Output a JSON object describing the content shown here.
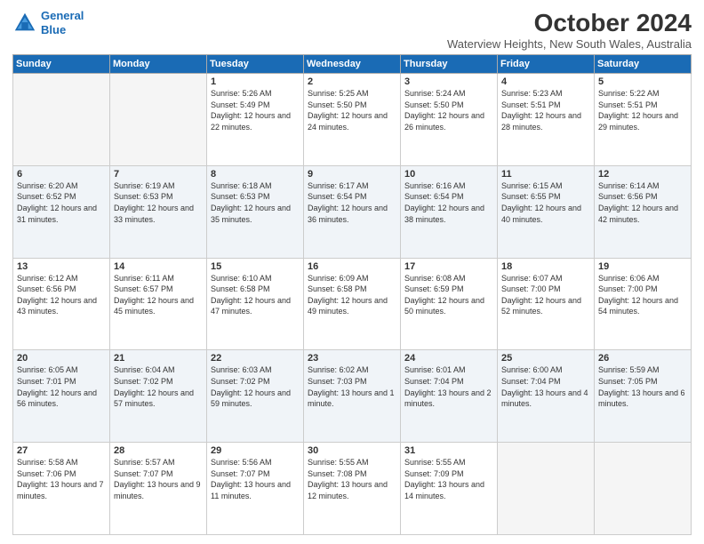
{
  "logo": {
    "line1": "General",
    "line2": "Blue"
  },
  "title": "October 2024",
  "subtitle": "Waterview Heights, New South Wales, Australia",
  "headers": [
    "Sunday",
    "Monday",
    "Tuesday",
    "Wednesday",
    "Thursday",
    "Friday",
    "Saturday"
  ],
  "weeks": [
    [
      {
        "day": "",
        "info": ""
      },
      {
        "day": "",
        "info": ""
      },
      {
        "day": "1",
        "info": "Sunrise: 5:26 AM\nSunset: 5:49 PM\nDaylight: 12 hours and 22 minutes."
      },
      {
        "day": "2",
        "info": "Sunrise: 5:25 AM\nSunset: 5:50 PM\nDaylight: 12 hours and 24 minutes."
      },
      {
        "day": "3",
        "info": "Sunrise: 5:24 AM\nSunset: 5:50 PM\nDaylight: 12 hours and 26 minutes."
      },
      {
        "day": "4",
        "info": "Sunrise: 5:23 AM\nSunset: 5:51 PM\nDaylight: 12 hours and 28 minutes."
      },
      {
        "day": "5",
        "info": "Sunrise: 5:22 AM\nSunset: 5:51 PM\nDaylight: 12 hours and 29 minutes."
      }
    ],
    [
      {
        "day": "6",
        "info": "Sunrise: 6:20 AM\nSunset: 6:52 PM\nDaylight: 12 hours and 31 minutes."
      },
      {
        "day": "7",
        "info": "Sunrise: 6:19 AM\nSunset: 6:53 PM\nDaylight: 12 hours and 33 minutes."
      },
      {
        "day": "8",
        "info": "Sunrise: 6:18 AM\nSunset: 6:53 PM\nDaylight: 12 hours and 35 minutes."
      },
      {
        "day": "9",
        "info": "Sunrise: 6:17 AM\nSunset: 6:54 PM\nDaylight: 12 hours and 36 minutes."
      },
      {
        "day": "10",
        "info": "Sunrise: 6:16 AM\nSunset: 6:54 PM\nDaylight: 12 hours and 38 minutes."
      },
      {
        "day": "11",
        "info": "Sunrise: 6:15 AM\nSunset: 6:55 PM\nDaylight: 12 hours and 40 minutes."
      },
      {
        "day": "12",
        "info": "Sunrise: 6:14 AM\nSunset: 6:56 PM\nDaylight: 12 hours and 42 minutes."
      }
    ],
    [
      {
        "day": "13",
        "info": "Sunrise: 6:12 AM\nSunset: 6:56 PM\nDaylight: 12 hours and 43 minutes."
      },
      {
        "day": "14",
        "info": "Sunrise: 6:11 AM\nSunset: 6:57 PM\nDaylight: 12 hours and 45 minutes."
      },
      {
        "day": "15",
        "info": "Sunrise: 6:10 AM\nSunset: 6:58 PM\nDaylight: 12 hours and 47 minutes."
      },
      {
        "day": "16",
        "info": "Sunrise: 6:09 AM\nSunset: 6:58 PM\nDaylight: 12 hours and 49 minutes."
      },
      {
        "day": "17",
        "info": "Sunrise: 6:08 AM\nSunset: 6:59 PM\nDaylight: 12 hours and 50 minutes."
      },
      {
        "day": "18",
        "info": "Sunrise: 6:07 AM\nSunset: 7:00 PM\nDaylight: 12 hours and 52 minutes."
      },
      {
        "day": "19",
        "info": "Sunrise: 6:06 AM\nSunset: 7:00 PM\nDaylight: 12 hours and 54 minutes."
      }
    ],
    [
      {
        "day": "20",
        "info": "Sunrise: 6:05 AM\nSunset: 7:01 PM\nDaylight: 12 hours and 56 minutes."
      },
      {
        "day": "21",
        "info": "Sunrise: 6:04 AM\nSunset: 7:02 PM\nDaylight: 12 hours and 57 minutes."
      },
      {
        "day": "22",
        "info": "Sunrise: 6:03 AM\nSunset: 7:02 PM\nDaylight: 12 hours and 59 minutes."
      },
      {
        "day": "23",
        "info": "Sunrise: 6:02 AM\nSunset: 7:03 PM\nDaylight: 13 hours and 1 minute."
      },
      {
        "day": "24",
        "info": "Sunrise: 6:01 AM\nSunset: 7:04 PM\nDaylight: 13 hours and 2 minutes."
      },
      {
        "day": "25",
        "info": "Sunrise: 6:00 AM\nSunset: 7:04 PM\nDaylight: 13 hours and 4 minutes."
      },
      {
        "day": "26",
        "info": "Sunrise: 5:59 AM\nSunset: 7:05 PM\nDaylight: 13 hours and 6 minutes."
      }
    ],
    [
      {
        "day": "27",
        "info": "Sunrise: 5:58 AM\nSunset: 7:06 PM\nDaylight: 13 hours and 7 minutes."
      },
      {
        "day": "28",
        "info": "Sunrise: 5:57 AM\nSunset: 7:07 PM\nDaylight: 13 hours and 9 minutes."
      },
      {
        "day": "29",
        "info": "Sunrise: 5:56 AM\nSunset: 7:07 PM\nDaylight: 13 hours and 11 minutes."
      },
      {
        "day": "30",
        "info": "Sunrise: 5:55 AM\nSunset: 7:08 PM\nDaylight: 13 hours and 12 minutes."
      },
      {
        "day": "31",
        "info": "Sunrise: 5:55 AM\nSunset: 7:09 PM\nDaylight: 13 hours and 14 minutes."
      },
      {
        "day": "",
        "info": ""
      },
      {
        "day": "",
        "info": ""
      }
    ]
  ]
}
